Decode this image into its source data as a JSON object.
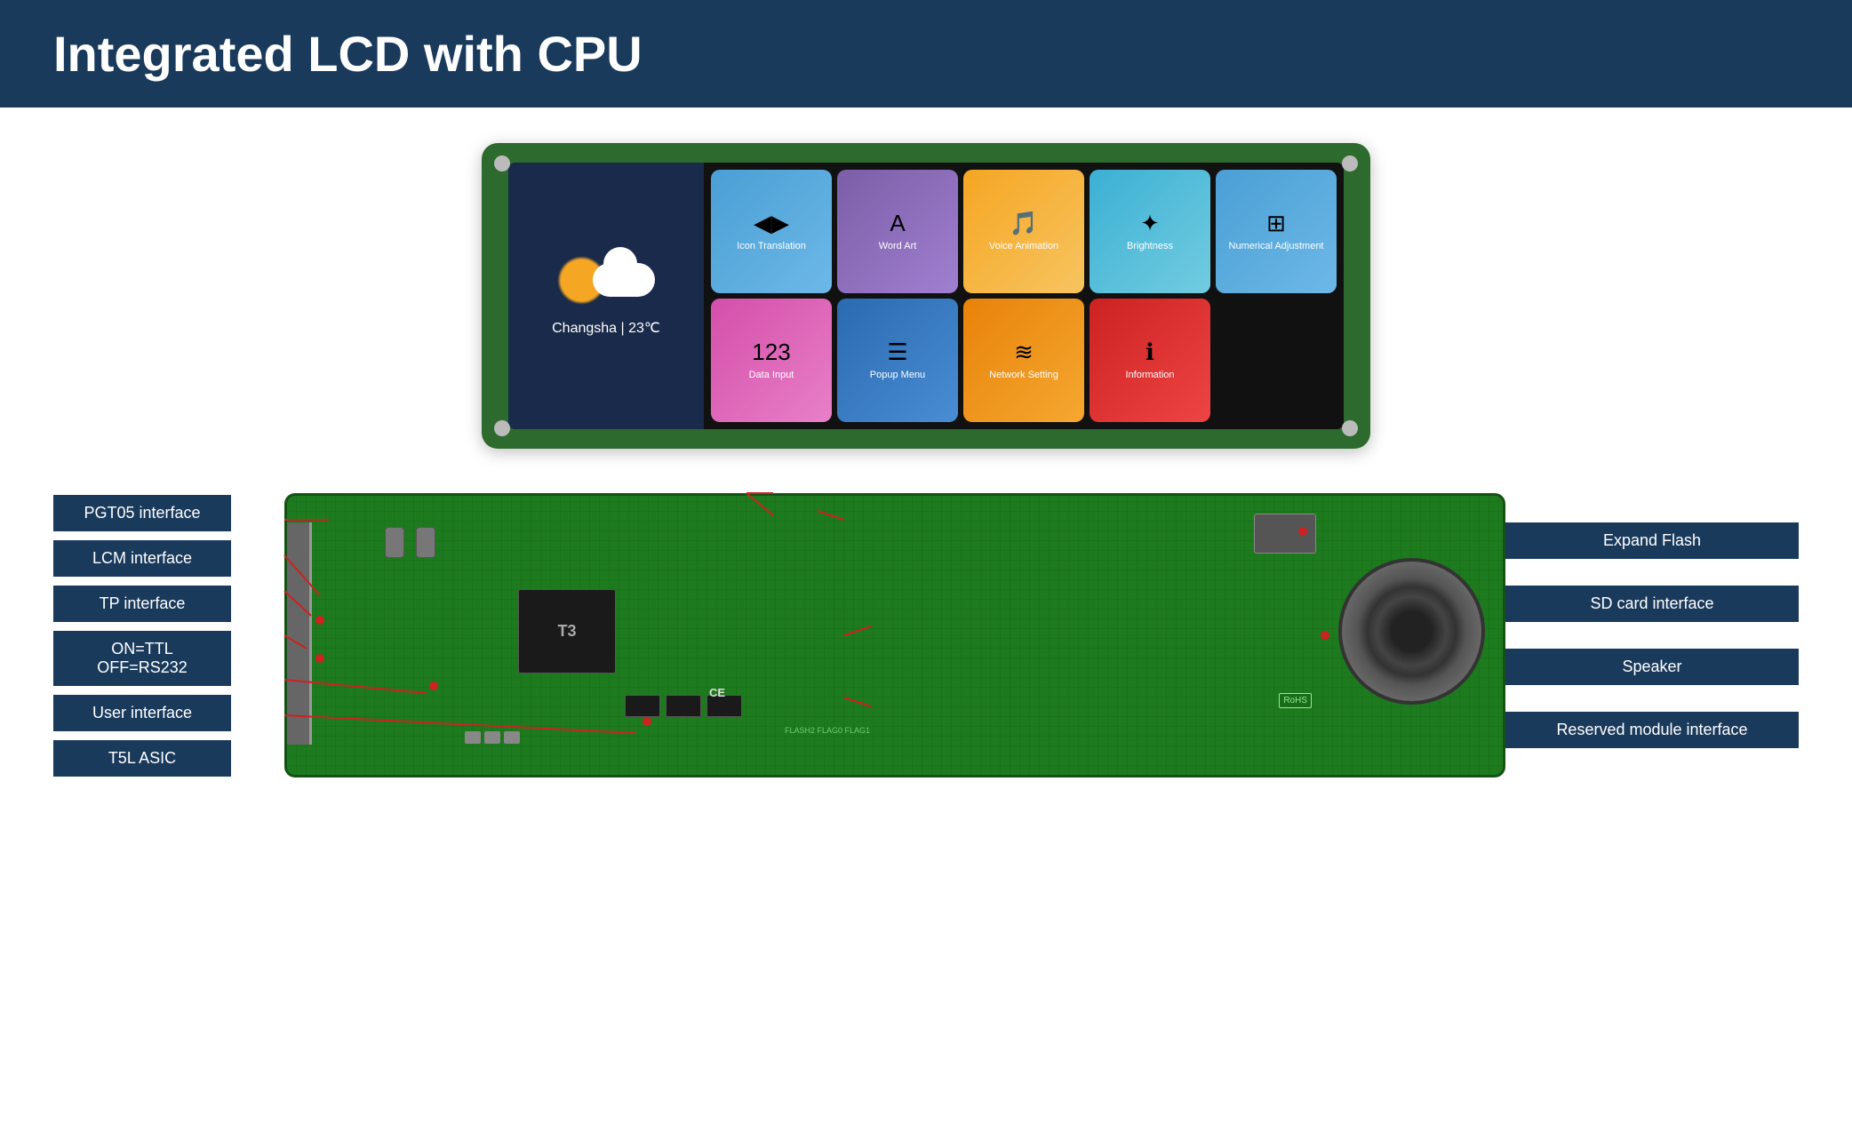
{
  "header": {
    "title": "Integrated LCD with CPU"
  },
  "lcd": {
    "weather": {
      "location": "Changsha | 23℃"
    },
    "apps": [
      {
        "label": "Icon Translation",
        "color": "tile-blue",
        "icon": "◀▶"
      },
      {
        "label": "Word Art",
        "color": "tile-purple",
        "icon": "A"
      },
      {
        "label": "Voice Animation",
        "color": "tile-orange",
        "icon": "🎵"
      },
      {
        "label": "Brightness",
        "color": "tile-light-blue",
        "icon": "✦"
      },
      {
        "label": "Numerical Adjustment",
        "color": "tile-blue",
        "icon": "⊞"
      },
      {
        "label": "Data Input",
        "color": "tile-magenta",
        "icon": "123"
      },
      {
        "label": "Popup Menu",
        "color": "tile-dark-blue",
        "icon": "☰"
      },
      {
        "label": "Network Setting",
        "color": "tile-orange2",
        "icon": "≋"
      },
      {
        "label": "Information",
        "color": "tile-red-info",
        "icon": "ℹ"
      }
    ]
  },
  "board": {
    "left_labels": [
      {
        "id": "pgt05",
        "text": "PGT05 interface"
      },
      {
        "id": "lcm",
        "text": "LCM interface"
      },
      {
        "id": "tp",
        "text": "TP interface"
      },
      {
        "id": "ttl",
        "text": "ON=TTL\nOFF=RS232"
      },
      {
        "id": "user",
        "text": "User interface"
      },
      {
        "id": "t5l",
        "text": "T5L ASIC"
      }
    ],
    "right_labels": [
      {
        "id": "expand-flash",
        "text": "Expand Flash"
      },
      {
        "id": "sd-card",
        "text": "SD card interface"
      },
      {
        "id": "speaker",
        "text": "Speaker"
      },
      {
        "id": "reserved",
        "text": "Reserved module interface"
      }
    ]
  }
}
